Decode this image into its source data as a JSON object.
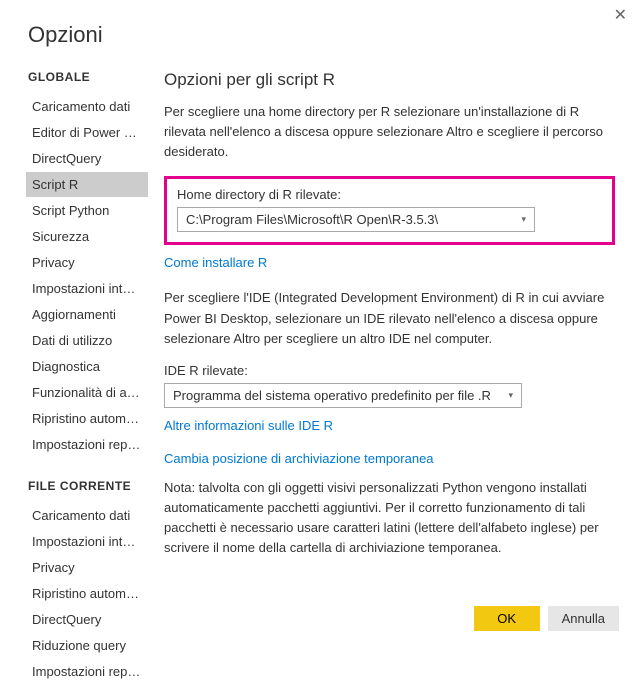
{
  "dialog": {
    "title": "Opzioni"
  },
  "sidebar": {
    "globalHeader": "GLOBALE",
    "globalItems": [
      "Caricamento dati",
      "Editor di Power Query",
      "DirectQuery",
      "Script R",
      "Script Python",
      "Sicurezza",
      "Privacy",
      "Impostazioni intern...",
      "Aggiornamenti",
      "Dati di utilizzo",
      "Diagnostica",
      "Funzionalità di ante...",
      "Ripristino automatico",
      "Impostazioni report"
    ],
    "selectedIndex": 3,
    "currentHeader": "FILE CORRENTE",
    "currentItems": [
      "Caricamento dati",
      "Impostazioni intern...",
      "Privacy",
      "Ripristino automatico",
      "DirectQuery",
      "Riduzione query",
      "Impostazioni report"
    ]
  },
  "main": {
    "title": "Opzioni per gli script R",
    "intro": "Per scegliere una home directory per R selezionare un'installazione di R rilevata nell'elenco a discesa oppure selezionare Altro e scegliere il percorso desiderato.",
    "homeLabel": "Home directory di R rilevate:",
    "homeValue": "C:\\Program Files\\Microsoft\\R Open\\R-3.5.3\\",
    "installLink": "Come installare R",
    "idePara": "Per scegliere l'IDE (Integrated Development Environment) di R in cui avviare Power BI Desktop, selezionare un IDE rilevato nell'elenco a discesa oppure selezionare Altro per scegliere un altro IDE nel computer.",
    "ideLabel": "IDE R rilevate:",
    "ideValue": "Programma del sistema operativo predefinito per file .R",
    "ideLink": "Altre informazioni sulle IDE R",
    "tempLink": "Cambia posizione di archiviazione temporanea",
    "note": "Nota: talvolta con gli oggetti visivi personalizzati Python vengono installati automaticamente pacchetti aggiuntivi. Per il corretto funzionamento di tali pacchetti è necessario usare caratteri latini (lettere dell'alfabeto inglese) per scrivere il nome della cartella di archiviazione temporanea."
  },
  "buttons": {
    "ok": "OK",
    "cancel": "Annulla"
  }
}
